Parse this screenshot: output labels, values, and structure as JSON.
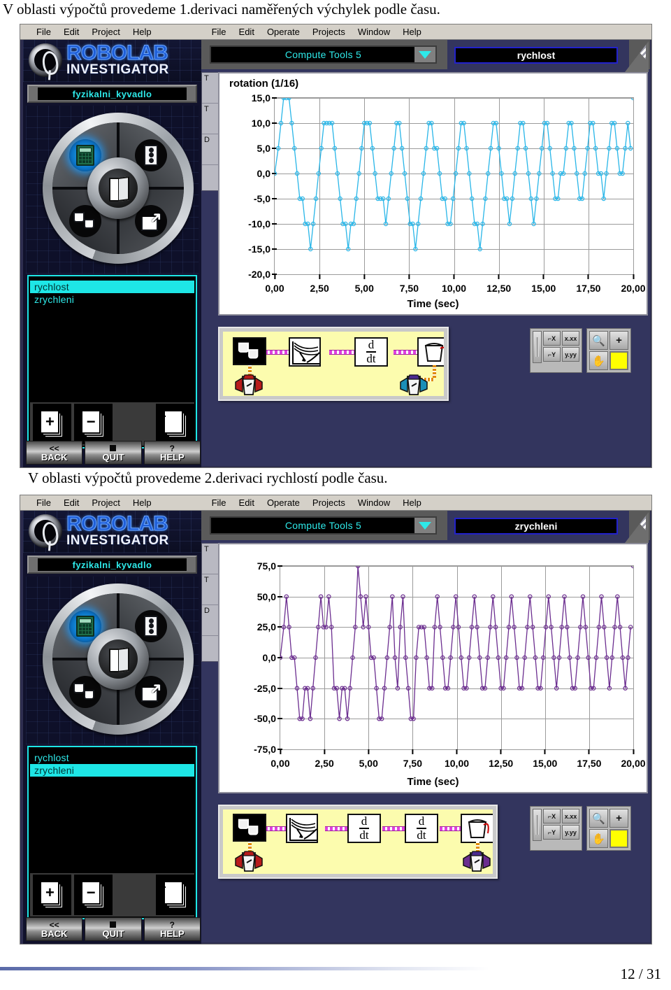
{
  "document": {
    "caption_1": "V oblasti výpočtů provedeme 1.derivaci naměřených výchylek podle času.",
    "caption_2": "V oblasti výpočtů provedeme 2.derivaci rychlostí podle času.",
    "footer_page": "12 / 31"
  },
  "menubar": {
    "left_group": [
      {
        "label": "File",
        "mnemonic": "F"
      },
      {
        "label": "Edit",
        "mnemonic": "E"
      },
      {
        "label": "Project",
        "mnemonic": ""
      },
      {
        "label": "Help",
        "mnemonic": "H"
      }
    ],
    "right_group": [
      {
        "label": "File",
        "mnemonic": "F"
      },
      {
        "label": "Edit",
        "mnemonic": "E"
      },
      {
        "label": "Operate",
        "mnemonic": "O"
      },
      {
        "label": "Projects",
        "mnemonic": "P"
      },
      {
        "label": "Window",
        "mnemonic": "W"
      },
      {
        "label": "Help",
        "mnemonic": "H"
      }
    ]
  },
  "branding": {
    "logo_line_1": "ROBOLAB",
    "logo_line_2": "INVESTIGATOR",
    "accent_cyan": "#2ee9e9",
    "accent_blue": "#1f5fd8",
    "panel_bg": "#33355e"
  },
  "panel_1": {
    "project_name": "fyzikalni_kyvadlo",
    "toolbar": {
      "combo_value": "Compute Tools 5",
      "title_value": "rychlost"
    },
    "list": {
      "items": [
        {
          "label": "rychlost",
          "selected": true
        },
        {
          "label": "zrychleni",
          "selected": false
        }
      ],
      "buttons": [
        {
          "name": "add-page",
          "symbol": "+"
        },
        {
          "name": "remove-page",
          "symbol": "−"
        },
        {
          "name": "list-pages",
          "symbol": ""
        }
      ]
    },
    "nav_buttons": [
      {
        "icon": "<<",
        "label": "BACK"
      },
      {
        "icon": "■",
        "label": "QUIT"
      },
      {
        "icon": "?",
        "label": "HELP"
      }
    ],
    "graph_tools": [
      "x-axis-format",
      "x.xx",
      "y-axis-format",
      "y.yy",
      "zoom",
      "+",
      "pan-hand",
      "color-swatch"
    ],
    "graph_tool_labels": {
      "x_format": "x.xx",
      "y_format": "y.yy",
      "cursor": "+",
      "swatch_color": "#ffff00"
    },
    "diagram": {
      "blocks": [
        {
          "name": "data-source-buckets",
          "type": "icon",
          "label": ""
        },
        {
          "name": "plot-graph",
          "type": "icon",
          "label": ""
        },
        {
          "name": "derivative-1",
          "type": "ddt",
          "numerator": "d",
          "denominator": "dt"
        },
        {
          "name": "output-bucket",
          "type": "icon",
          "label": ""
        }
      ]
    }
  },
  "panel_2": {
    "project_name": "fyzikalni_kyvadlo",
    "toolbar": {
      "combo_value": "Compute Tools 5",
      "title_value": "zrychleni"
    },
    "list": {
      "items": [
        {
          "label": "rychlost",
          "selected": false
        },
        {
          "label": "zrychleni",
          "selected": true
        }
      ],
      "buttons": [
        {
          "name": "add-page",
          "symbol": "+"
        },
        {
          "name": "remove-page",
          "symbol": "−"
        },
        {
          "name": "list-pages",
          "symbol": ""
        }
      ]
    },
    "nav_buttons": [
      {
        "icon": "<<",
        "label": "BACK"
      },
      {
        "icon": "■",
        "label": "QUIT"
      },
      {
        "icon": "?",
        "label": "HELP"
      }
    ],
    "graph_tool_labels": {
      "x_format": "x.xx",
      "y_format": "y.yy",
      "cursor": "+",
      "swatch_color": "#ffff00"
    },
    "diagram": {
      "blocks": [
        {
          "name": "data-source-buckets",
          "type": "icon",
          "label": ""
        },
        {
          "name": "plot-graph",
          "type": "icon",
          "label": ""
        },
        {
          "name": "derivative-1",
          "type": "ddt",
          "numerator": "d",
          "denominator": "dt"
        },
        {
          "name": "derivative-2",
          "type": "ddt",
          "numerator": "d",
          "denominator": "dt"
        },
        {
          "name": "output-bucket",
          "type": "icon",
          "label": ""
        }
      ]
    }
  },
  "behind_window": {
    "rows": [
      "T",
      "T",
      "D"
    ]
  },
  "chart_data": [
    {
      "type": "line",
      "title": "rotation (1/16)",
      "xlabel": "Time (sec)",
      "ylabel": "",
      "series_name": "rychlost",
      "color": "#29b6e8",
      "marker": "circle-open",
      "grid": true,
      "legend": "none",
      "xlim": [
        0,
        20
      ],
      "ylim": [
        -20,
        15
      ],
      "yticks": [
        "15,0",
        "10,0",
        "5,0",
        "0,0",
        "-5,0",
        "-10,0",
        "-15,0",
        "-20,0"
      ],
      "ytick_values": [
        15,
        10,
        5,
        0,
        -5,
        -10,
        -15,
        -20
      ],
      "xticks": [
        "0,00",
        "2,50",
        "5,00",
        "7,50",
        "10,00",
        "12,50",
        "15,00",
        "17,50",
        "20,00"
      ],
      "xtick_values": [
        0,
        2.5,
        5,
        7.5,
        10,
        12.5,
        15,
        17.5,
        20
      ],
      "x": [
        0.0,
        0.2,
        0.35,
        0.5,
        0.65,
        0.8,
        0.95,
        1.1,
        1.25,
        1.4,
        1.55,
        1.7,
        1.85,
        2.0,
        2.15,
        2.3,
        2.45,
        2.6,
        2.75,
        2.9,
        3.05,
        3.2,
        3.35,
        3.5,
        3.65,
        3.8,
        3.95,
        4.1,
        4.25,
        4.4,
        4.55,
        4.7,
        4.85,
        5.0,
        5.15,
        5.3,
        5.45,
        5.6,
        5.75,
        5.9,
        6.05,
        6.2,
        6.35,
        6.5,
        6.65,
        6.8,
        6.95,
        7.1,
        7.25,
        7.4,
        7.55,
        7.7,
        7.85,
        8.0,
        8.15,
        8.3,
        8.45,
        8.6,
        8.75,
        8.9,
        9.05,
        9.2,
        9.35,
        9.5,
        9.65,
        9.8,
        9.95,
        10.1,
        10.25,
        10.4,
        10.55,
        10.7,
        10.85,
        11.0,
        11.15,
        11.3,
        11.45,
        11.6,
        11.75,
        11.9,
        12.05,
        12.2,
        12.35,
        12.5,
        12.65,
        12.8,
        12.95,
        13.1,
        13.25,
        13.4,
        13.55,
        13.7,
        13.85,
        14.0,
        14.15,
        14.3,
        14.45,
        14.6,
        14.75,
        14.9,
        15.05,
        15.2,
        15.35,
        15.5,
        15.65,
        15.8,
        15.95,
        16.1,
        16.25,
        16.4,
        16.55,
        16.7,
        16.85,
        17.0,
        17.15,
        17.3,
        17.45,
        17.6,
        17.75,
        17.9,
        18.05,
        18.2,
        18.35,
        18.5,
        18.65,
        18.8,
        18.95,
        19.1,
        19.25,
        19.4,
        19.55,
        19.7,
        19.85,
        20.0
      ],
      "y": [
        0,
        5,
        10,
        15,
        15,
        15,
        10,
        5,
        0,
        -5,
        -5,
        -10,
        -10,
        -15,
        -10,
        -5,
        0,
        5,
        10,
        10,
        10,
        10,
        5,
        0,
        -5,
        -10,
        -10,
        -15,
        -10,
        -10,
        -5,
        0,
        5,
        10,
        10,
        10,
        5,
        0,
        -5,
        -5,
        -5,
        -10,
        -5,
        0,
        5,
        10,
        10,
        5,
        0,
        -5,
        -10,
        -10,
        -15,
        -10,
        -5,
        0,
        5,
        10,
        10,
        5,
        5,
        0,
        -5,
        -5,
        -10,
        -10,
        -5,
        0,
        5,
        10,
        10,
        5,
        0,
        -5,
        -10,
        -10,
        -15,
        -10,
        -5,
        0,
        5,
        10,
        10,
        5,
        0,
        -5,
        -5,
        -10,
        -5,
        0,
        5,
        10,
        10,
        5,
        0,
        -5,
        -10,
        -5,
        0,
        5,
        10,
        10,
        5,
        0,
        -5,
        -5,
        0,
        0,
        5,
        10,
        10,
        5,
        0,
        -5,
        -5,
        0,
        5,
        10,
        10,
        5,
        0,
        0,
        -5,
        0,
        5,
        10,
        10,
        5,
        0,
        0,
        5,
        10,
        5
      ]
    },
    {
      "type": "line",
      "title": "",
      "xlabel": "Time (sec)",
      "ylabel": "",
      "series_name": "zrychleni",
      "color": "#6b2d8f",
      "marker": "circle-open",
      "grid": true,
      "legend": "none",
      "xlim": [
        0,
        20
      ],
      "ylim": [
        -75,
        75
      ],
      "yticks": [
        "75,0",
        "50,0",
        "25,0",
        "0,0",
        "-25,0",
        "-50,0",
        "-75,0"
      ],
      "ytick_values": [
        75,
        50,
        25,
        0,
        -25,
        -50,
        -75
      ],
      "xticks": [
        "0,00",
        "2,50",
        "5,00",
        "7,50",
        "10,00",
        "12,50",
        "15,00",
        "17,50",
        "20,00"
      ],
      "xtick_values": [
        0,
        2.5,
        5,
        7.5,
        10,
        12.5,
        15,
        17.5,
        20
      ],
      "x": [
        0.0,
        0.2,
        0.35,
        0.5,
        0.65,
        0.8,
        0.95,
        1.1,
        1.25,
        1.4,
        1.55,
        1.7,
        1.85,
        2.0,
        2.15,
        2.3,
        2.45,
        2.6,
        2.75,
        2.9,
        3.05,
        3.2,
        3.35,
        3.5,
        3.65,
        3.8,
        3.95,
        4.1,
        4.25,
        4.4,
        4.55,
        4.7,
        4.85,
        5.0,
        5.15,
        5.3,
        5.45,
        5.6,
        5.75,
        5.9,
        6.05,
        6.2,
        6.35,
        6.5,
        6.65,
        6.8,
        6.95,
        7.1,
        7.25,
        7.4,
        7.55,
        7.7,
        7.85,
        8.0,
        8.15,
        8.3,
        8.45,
        8.6,
        8.75,
        8.9,
        9.05,
        9.2,
        9.35,
        9.5,
        9.65,
        9.8,
        9.95,
        10.1,
        10.25,
        10.4,
        10.55,
        10.7,
        10.85,
        11.0,
        11.15,
        11.3,
        11.45,
        11.6,
        11.75,
        11.9,
        12.05,
        12.2,
        12.35,
        12.5,
        12.65,
        12.8,
        12.95,
        13.1,
        13.25,
        13.4,
        13.55,
        13.7,
        13.85,
        14.0,
        14.15,
        14.3,
        14.45,
        14.6,
        14.75,
        14.9,
        15.05,
        15.2,
        15.35,
        15.5,
        15.65,
        15.8,
        15.95,
        16.1,
        16.25,
        16.4,
        16.55,
        16.7,
        16.85,
        17.0,
        17.15,
        17.3,
        17.45,
        17.6,
        17.75,
        17.9,
        18.05,
        18.2,
        18.35,
        18.5,
        18.65,
        18.8,
        18.95,
        19.1,
        19.25,
        19.4,
        19.55,
        19.7,
        19.85,
        20.0
      ],
      "y": [
        0,
        25,
        50,
        25,
        0,
        0,
        -25,
        -50,
        -50,
        -25,
        -25,
        -50,
        -25,
        0,
        25,
        50,
        25,
        25,
        50,
        25,
        -25,
        -25,
        -50,
        -25,
        -25,
        -50,
        -25,
        0,
        25,
        75,
        50,
        25,
        50,
        25,
        0,
        0,
        -25,
        -50,
        -50,
        -25,
        0,
        25,
        50,
        0,
        -25,
        25,
        50,
        0,
        -25,
        -50,
        -50,
        0,
        25,
        25,
        25,
        0,
        -25,
        -25,
        25,
        50,
        25,
        0,
        -25,
        -25,
        0,
        25,
        50,
        25,
        0,
        -25,
        -25,
        0,
        25,
        50,
        25,
        0,
        -25,
        -25,
        0,
        25,
        50,
        25,
        0,
        -25,
        -25,
        0,
        25,
        50,
        25,
        0,
        -25,
        -25,
        0,
        25,
        50,
        25,
        0,
        -25,
        -25,
        0,
        25,
        50,
        25,
        0,
        -25,
        0,
        25,
        50,
        25,
        0,
        -25,
        -25,
        0,
        25,
        50,
        25,
        0,
        -25,
        -25,
        0,
        25,
        50,
        25,
        0,
        -25,
        0,
        25,
        50,
        25,
        0,
        -25,
        0,
        25
      ]
    }
  ]
}
